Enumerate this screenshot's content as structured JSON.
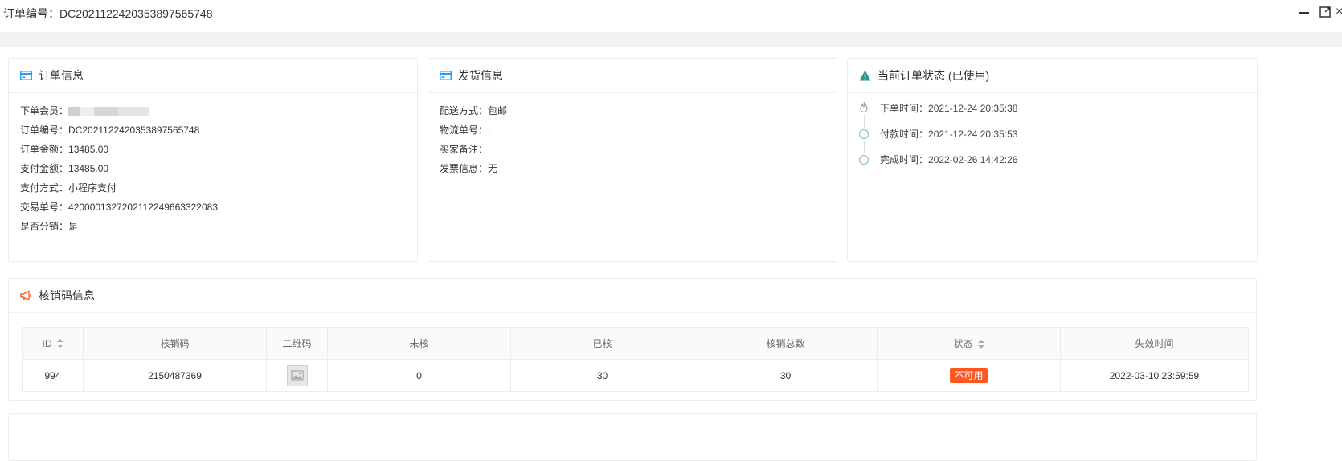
{
  "window": {
    "title": "订单编号：DC202112242035389756574​8",
    "close_glyph": "×"
  },
  "order_info": {
    "title": "订单信息",
    "rows": [
      {
        "label": "下单会员：",
        "value": ""
      },
      {
        "label": "订单编号：",
        "value": "DC202112242035389756574​8"
      },
      {
        "label": "订单金额：",
        "value": "13485.00"
      },
      {
        "label": "支付金额：",
        "value": "13485.00"
      },
      {
        "label": "支付方式：",
        "value": "小程序支付"
      },
      {
        "label": "交易单号：",
        "value": "4200001327202112249663322083"
      },
      {
        "label": "是否分销：",
        "value": "是"
      }
    ]
  },
  "shipping_info": {
    "title": "发货信息",
    "rows": [
      {
        "label": "配送方式：",
        "value": "包邮"
      },
      {
        "label": "物流单号：",
        "value": ","
      },
      {
        "label": "买家备注：",
        "value": ""
      },
      {
        "label": "发票信息：",
        "value": "无"
      }
    ]
  },
  "status_info": {
    "title": "当前订单状态 (已使用)",
    "timeline": [
      {
        "label": "下单时间：",
        "value": "2021-12-24 20:35:38"
      },
      {
        "label": "付款时间：",
        "value": "2021-12-24 20:35:53"
      },
      {
        "label": "完成时间：",
        "value": "2022-02-26 14:42:26"
      }
    ]
  },
  "verify_info": {
    "title": "核销码信息",
    "headers": [
      "ID",
      "核销码",
      "二维码",
      "未核",
      "已核",
      "核销总数",
      "状态",
      "失效时间"
    ],
    "row": {
      "id": "994",
      "code": "2150487369",
      "unverified": "0",
      "verified": "30",
      "total": "30",
      "status": "不可用",
      "expire": "2022-03-10 23:59:59"
    }
  },
  "colors": {
    "accent_blue": "#1e9fff",
    "status_red": "#ff5722",
    "warn_green": "#2f9688",
    "horn_red": "#ff5722"
  }
}
